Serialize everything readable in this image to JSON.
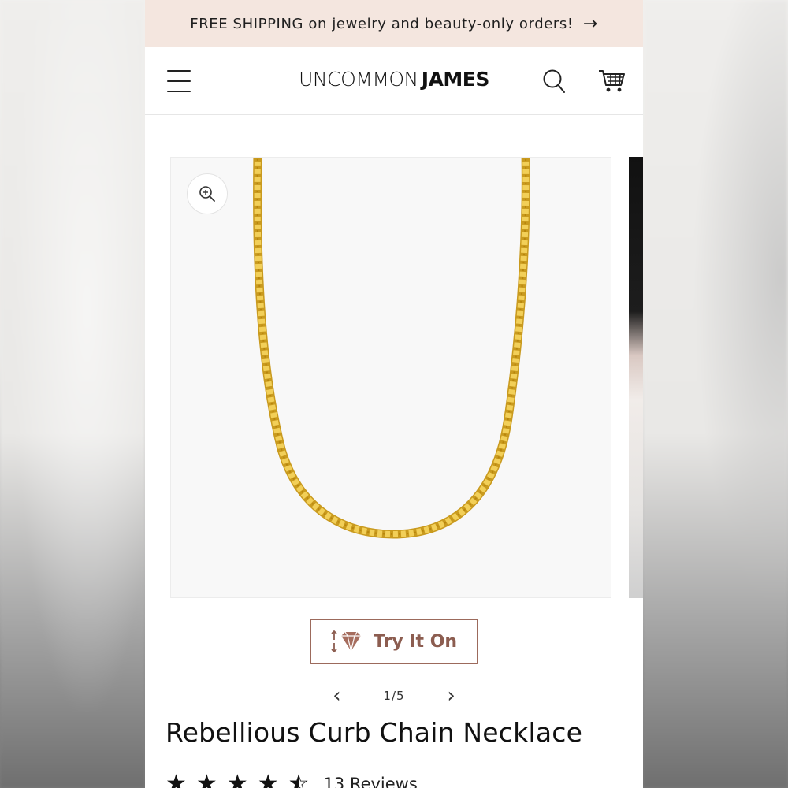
{
  "announcement": {
    "text": "FREE SHIPPING on jewelry and beauty-only orders!",
    "arrow": "→"
  },
  "header": {
    "logo_light": "UNCOMMON",
    "logo_bold": "JAMES",
    "menu_icon": "hamburger-menu-icon",
    "search_icon": "search-icon",
    "cart_icon": "cart-icon"
  },
  "gallery": {
    "zoom_icon": "zoom-in-icon",
    "try_on_label": "Try It On",
    "try_on_icon": "try-on-gem-icon",
    "page_indicator": "1/5",
    "prev_symbol": "‹",
    "next_symbol": "›"
  },
  "product": {
    "title": "Rebellious Curb Chain Necklace",
    "rating": 4.5,
    "reviews_label": "13 Reviews"
  },
  "colors": {
    "announcement_bg": "#f4e6df",
    "accent": "#9c6a5c",
    "chain_gold": "#e2b93b"
  }
}
